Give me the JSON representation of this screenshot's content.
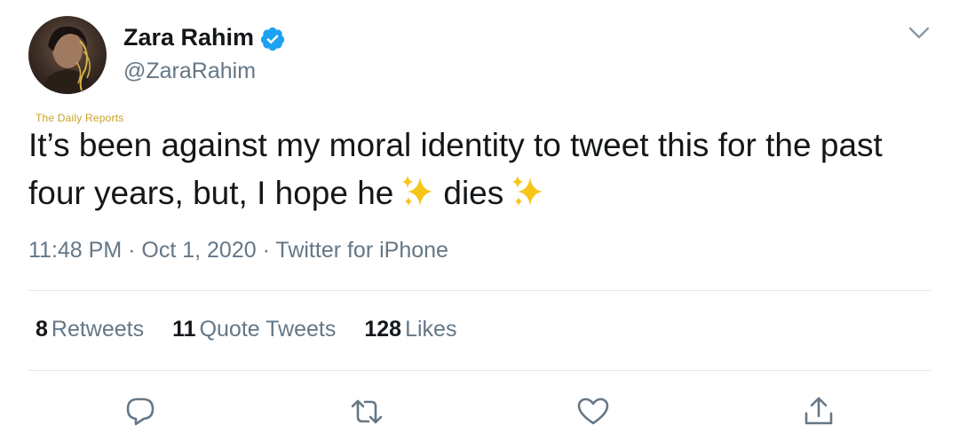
{
  "author": {
    "display_name": "Zara Rahim",
    "handle": "@ZaraRahim",
    "verified": true
  },
  "watermark": "The Daily Reports",
  "tweet": {
    "text_part1": "It’s been against my moral identity to tweet this for the past four years, but, I hope he",
    "text_part2": "dies"
  },
  "meta": {
    "time": "11:48 PM",
    "separator": "·",
    "date": "Oct 1, 2020",
    "source": "Twitter for iPhone"
  },
  "stats": {
    "retweets_count": "8",
    "retweets_label": "Retweets",
    "quotes_count": "11",
    "quotes_label": "Quote Tweets",
    "likes_count": "128",
    "likes_label": "Likes"
  },
  "icons": {
    "verified": "verified-badge-icon",
    "caret": "chevron-down-icon",
    "sparkles": "sparkles-emoji-icon",
    "reply": "reply-icon",
    "retweet": "retweet-icon",
    "like": "heart-icon",
    "share": "share-icon"
  },
  "colors": {
    "verified_blue": "#1da1f2",
    "secondary_text": "#657786",
    "primary_text": "#14171a",
    "divider": "#e1e8ed",
    "sparkle": "#f5c518"
  }
}
